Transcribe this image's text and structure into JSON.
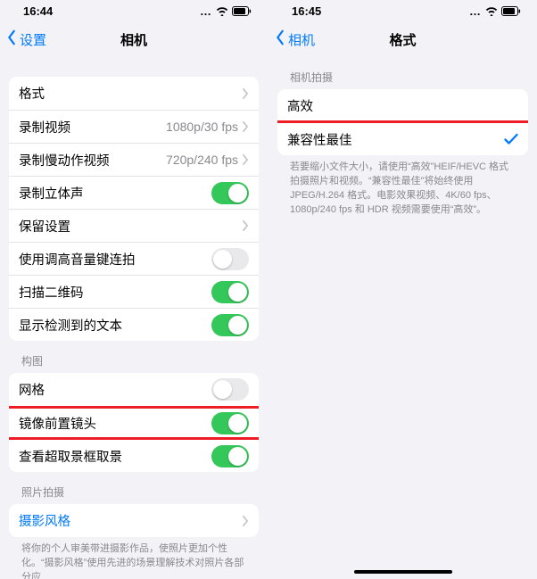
{
  "left": {
    "status_time": "16:44",
    "back_label": "设置",
    "title": "相机",
    "rows": {
      "format": "格式",
      "record_video": "录制视频",
      "record_video_detail": "1080p/30 fps",
      "record_slomo": "录制慢动作视频",
      "record_slomo_detail": "720p/240 fps",
      "stereo": "录制立体声",
      "preserve": "保留设置",
      "volume_burst": "使用调高音量键连拍",
      "scan_qr": "扫描二维码",
      "detected_text": "显示检测到的文本"
    },
    "composition_header": "构图",
    "composition": {
      "grid": "网格",
      "mirror_front": "镜像前置镜头",
      "view_outside": "查看超取景框取景"
    },
    "photo_header": "照片拍摄",
    "photo": {
      "styles": "摄影风格"
    },
    "photo_footer": "将你的个人审美带进摄影作品，使照片更加个性化。“摄影风格”使用先进的场景理解技术对照片各部分应"
  },
  "right": {
    "status_time": "16:45",
    "back_label": "相机",
    "title": "格式",
    "section_header": "相机拍摄",
    "rows": {
      "high_eff": "高效",
      "most_compat": "兼容性最佳"
    },
    "footer": "若要缩小文件大小，请使用“高效”HEIF/HEVC 格式拍摄照片和视频。“兼容性最佳”将始终使用 JPEG/H.264 格式。电影效果视频、4K/60 fps、1080p/240 fps 和 HDR 视频需要使用“高效”。"
  }
}
